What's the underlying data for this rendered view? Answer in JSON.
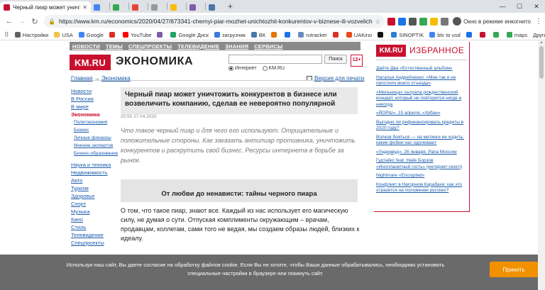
{
  "browser": {
    "active_tab_title": "Черный пиар может уничтож",
    "background_tab_titles": [
      "",
      "",
      "",
      "",
      "",
      "",
      ""
    ],
    "url": "https://www.km.ru/economics/2020/04/27/873341-chernyi-piar-mozhet-unichtozhit-konkurentov-v-biznese-ili-vozvelichit-ko",
    "incognito_label": "Окно в режиме инкогнито",
    "colors": {
      "tabstrip": "#dee1e6",
      "omnibox": "#f1f3f4"
    }
  },
  "bookmarks": {
    "items": [
      {
        "label": "Настройки",
        "icon": "gear-icon",
        "color": "#5f6368"
      },
      {
        "label": "USA",
        "icon": "folder-icon",
        "color": "#f2c14e"
      },
      {
        "label": "Google",
        "icon": "google-icon",
        "color": "#4285f4"
      },
      {
        "label": "",
        "icon": "gmail-icon",
        "color": "#d93025"
      },
      {
        "label": "YouTube",
        "icon": "youtube-icon",
        "color": "#ff0000"
      },
      {
        "label": "",
        "icon": "ext-icon",
        "color": "#7b5ea7"
      },
      {
        "label": "Google Диск",
        "icon": "drive-icon",
        "color": "#1fa463"
      },
      {
        "label": "загрузчик",
        "icon": "download-icon",
        "color": "#3c78d8"
      },
      {
        "label": "ВК",
        "icon": "vk-icon",
        "color": "#4a76a8"
      },
      {
        "label": "",
        "icon": "ext-icon",
        "color": "#e37400"
      },
      {
        "label": "",
        "icon": "ext-icon",
        "color": "#1a73e8"
      },
      {
        "label": "rutracker",
        "icon": "rutracker-icon",
        "color": "#6a8cbc"
      },
      {
        "label": "",
        "icon": "ext-icon",
        "color": "#d93025"
      },
      {
        "label": "UAKino",
        "icon": "uakino-icon",
        "color": "#e64a19"
      },
      {
        "label": "",
        "icon": "ext-icon",
        "color": "#111"
      },
      {
        "label": "SINOPTIK",
        "icon": "weather-icon",
        "color": "#2e7dd1"
      },
      {
        "label": "btc to usd",
        "icon": "google-icon",
        "color": "#4285f4"
      },
      {
        "label": "",
        "icon": "ext-icon",
        "color": "#1a73e8"
      },
      {
        "label": "",
        "icon": "ext-icon",
        "color": "#c8102e"
      },
      {
        "label": "",
        "icon": "ext-icon",
        "color": "#34a853"
      },
      {
        "label": "maps",
        "icon": "maps-icon",
        "color": "#34a853"
      }
    ],
    "other": "Другие закладки"
  },
  "site": {
    "topnav": [
      "НОВОСТИ",
      "ТЕМЫ",
      "СПЕЦПРОЕКТЫ",
      "ТЕЛЕВИДЕНИЕ",
      "ЗНАНИЯ",
      "СЕРВИСЫ"
    ],
    "logo": "KM.RU",
    "section": "ЭКОНОМИКА",
    "search_button": "Поиск",
    "search_value": "",
    "age": "12+",
    "radio_internet": "Интернет",
    "radio_kmru": "KM.RU",
    "breadcrumb_home": "Главная",
    "breadcrumb_arrow": "→",
    "breadcrumb_section": "Экономика",
    "print_version": "Версия для печати",
    "brand_color": "#c8102e"
  },
  "leftnav": [
    {
      "label": "Новости",
      "type": "li"
    },
    {
      "label": "В России",
      "type": "li"
    },
    {
      "label": "В мире",
      "type": "li"
    },
    {
      "label": "Экономика",
      "type": "active"
    },
    {
      "label": "Политэкономия",
      "type": "sub"
    },
    {
      "label": "Бизнес",
      "type": "sub"
    },
    {
      "label": "Личные финансы",
      "type": "sub"
    },
    {
      "label": "Мнение экспертов",
      "type": "sub"
    },
    {
      "label": "Бизнес-образование",
      "type": "sub"
    },
    {
      "label": "",
      "type": "gap"
    },
    {
      "label": "Наука и техника",
      "type": "li"
    },
    {
      "label": "Недвижимость",
      "type": "li"
    },
    {
      "label": "Авто",
      "type": "li"
    },
    {
      "label": "Туризм",
      "type": "li"
    },
    {
      "label": "Здоровье",
      "type": "li"
    },
    {
      "label": "Спорт",
      "type": "li"
    },
    {
      "label": "Музыка",
      "type": "li"
    },
    {
      "label": "Кино",
      "type": "li"
    },
    {
      "label": "Стиль",
      "type": "li"
    },
    {
      "label": "Телевидение",
      "type": "li"
    },
    {
      "label": "Спецпроекты",
      "type": "li"
    }
  ],
  "article": {
    "title": "Черный пиар может уничтожить конкурентов в бизнесе или возвеличить компанию, сделав ее невероятно популярной",
    "date": "20:50 27.04.2020",
    "lead": "Что такое черный пиар и для чего его используют. Отрицательные и положительные стороны. Как заказать антипиар противника, уничтожить конкурентов и раскрутить свой бизнес. Ресурсы интернета в борьбе за рынок.",
    "subheading": "От любви до ненависти: тайны черного пиара",
    "body": "О том, что такое пиар, знают все. Каждый из нас использует его магическую силу, не думая о сути. Отпуская комплименты окружающим – врачам, продавцам, коллегам, сами того не ведая, мы создаем образы людей, близких к идеалу."
  },
  "sidebar": {
    "logo": "KM.RU",
    "title": "ИЗБРАННОЕ",
    "items": [
      "Дайте Два «Естественный альбом»",
      "Наталья Андрейченко: «Мне так и не простили моего отъезда»",
      "«Мельница» сыграла рождественский концерт, который не повторится нигде и никогда",
      "«ЙОРШ», 15 апреля, «Урбан»",
      "Выгодно ли рефинансировать кредиты в 2020 году?",
      "Волков бояться — на митинги не ходить: какие фобии нас одолевают",
      "«Ундервуд», 26 января, Рапа Moscow",
      "Гудтайкс feat. Найк Борзов «Инопланетный гость» (интернет-сингл)",
      "Nightmare «Encrypted»",
      "Конфликт в Нагорном Карабахе: как это отразится на положении русских?"
    ]
  },
  "cookie": {
    "text": "Используя наш сайт, Вы даете согласие на обработку файлов cookie. Если Вы не хотите, чтобы Ваши данные обрабатывались, необходимо установить специальные настройки в браузере или покинуть сайт.",
    "accept": "Принять",
    "button_color": "#f29100"
  }
}
